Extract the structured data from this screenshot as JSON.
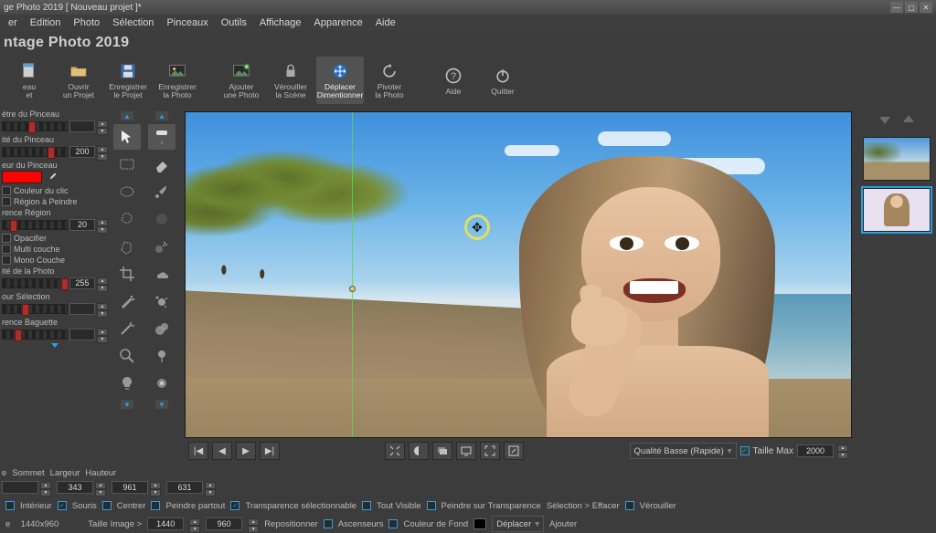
{
  "titlebar": {
    "text": "ge Photo 2019 [ Nouveau projet ]*"
  },
  "menu": {
    "items": [
      "er",
      "Edition",
      "Photo",
      "Sélection",
      "Pinceaux",
      "Outils",
      "Affichage",
      "Apparence",
      "Aide"
    ]
  },
  "app": {
    "name": "ntage Photo 2019"
  },
  "toolbar": {
    "items": [
      {
        "id": "new-project",
        "line1": "eau",
        "line2": "et"
      },
      {
        "id": "open-project",
        "line1": "Ouvrir",
        "line2": "un Projet"
      },
      {
        "id": "save-project",
        "line1": "Enregistrer",
        "line2": "le Projet"
      },
      {
        "id": "save-photo",
        "line1": "Enregistrer",
        "line2": "la Photo"
      },
      {
        "id": "add-photo",
        "line1": "Ajouter",
        "line2": "une Photo"
      },
      {
        "id": "lock-scene",
        "line1": "Vérouiller",
        "line2": "la Scène"
      },
      {
        "id": "move-resize",
        "line1": "Déplacer",
        "line2": "Dimentionner"
      },
      {
        "id": "rotate-photo",
        "line1": "Pivoter",
        "line2": "la Photo"
      },
      {
        "id": "help",
        "line1": "Aide",
        "line2": ""
      },
      {
        "id": "quit",
        "line1": "Quitter",
        "line2": ""
      }
    ],
    "active_id": "move-resize"
  },
  "left_panel": {
    "diameter_label": "ètre du Pinceau",
    "opacity_label": "ité du Pinceau",
    "opacity_value": "200",
    "color_label": "eur du Pinceau",
    "click_color": "Couleur du clic",
    "region_paint": "Région à Peindre",
    "diff_region": "rence Région",
    "diff_value": "20",
    "opacify": "Opacifier",
    "multi_layer": "Multi couche",
    "mono_layer": "Mono Couche",
    "photo_density": "ité de la Photo",
    "density_value": "255",
    "sel_color": "our Sélection",
    "wand_diff": "rence Baguette"
  },
  "canvas_nav": {
    "quality": "Qualité Basse (Rapide)",
    "size_max_label": "Taille Max",
    "size_max_value": "2000"
  },
  "opt1": {
    "sommet_label": "Sommet",
    "sommet_value": "343",
    "largeur_label": "Largeur",
    "largeur_value": "961",
    "hauteur_label": "Hauteur",
    "hauteur_value": "631"
  },
  "opt2": {
    "interieur": "Intérieur",
    "souris": "Souris",
    "centrer": "Centrer",
    "peindre_partout": "Peindre partout",
    "transp_sel": "Transparence sélectionnable",
    "tout_visible": "Tout Visible",
    "peindre_sur_transp": "Peindre sur Transparence",
    "sel_effacer": "Sélection > Effacer",
    "verouiller": "Vérouiller"
  },
  "opt3": {
    "dims": "1440x960",
    "taille_image": "Taille Image >",
    "w": "1440",
    "h": "960",
    "repositionner": "Repositionner",
    "ascenseurs": "Ascenseurs",
    "couleur_fond": "Couleur de Fond",
    "deplacer": "Déplacer",
    "ajouter": "Ajouter"
  }
}
